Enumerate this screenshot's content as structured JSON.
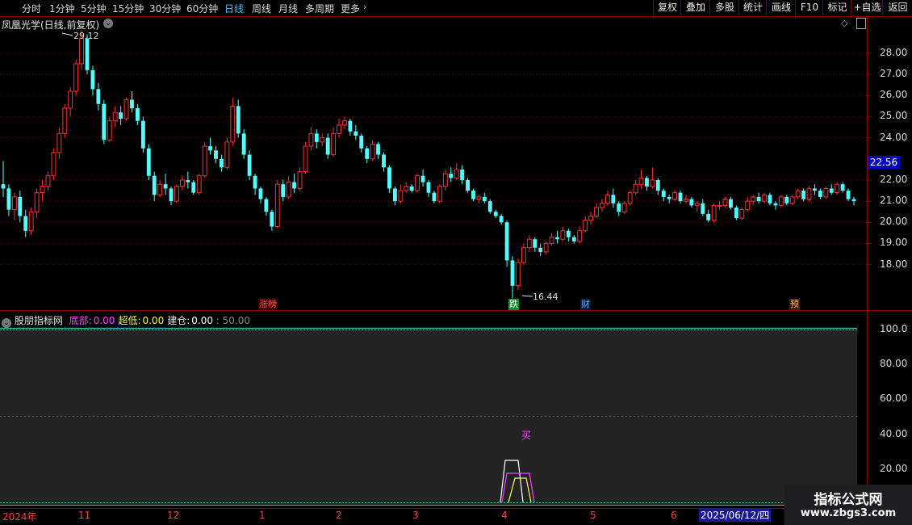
{
  "toolbar": {
    "timeframes": [
      "分时",
      "1分钟",
      "5分钟",
      "15分钟",
      "30分钟",
      "60分钟",
      "日线",
      "周线",
      "月线",
      "多周期",
      "更多"
    ],
    "active_timeframe": "日线",
    "right_buttons": [
      "复权",
      "叠加",
      "多股",
      "统计",
      "画线",
      "F10",
      "标记",
      "+自选",
      "返回"
    ]
  },
  "chart": {
    "title": "凤凰光学(日线,前复权)",
    "high_label": "29.12",
    "low_label": "16.44",
    "current_price": "22.56",
    "price_axis": [
      "28.00",
      "27.00",
      "26.00",
      "25.00",
      "24.00",
      "22.00",
      "21.00",
      "20.00",
      "19.00",
      "18.00"
    ],
    "event_tags": [
      {
        "text": "涨榜",
        "color": "#ff5050",
        "bg": "#3a0000"
      },
      {
        "text": "跌",
        "color": "#ffffff",
        "bg": "#138a2c"
      },
      {
        "text": "财",
        "color": "#60a8ff",
        "bg": "#0c1a38"
      },
      {
        "text": "预",
        "color": "#ffb070",
        "bg": "#3a1a00"
      }
    ]
  },
  "indicator": {
    "name": "股朋指标网",
    "fields": [
      {
        "label": "底部:",
        "value": "0.00",
        "color": "#ff40ff"
      },
      {
        "label": "超低:",
        "value": "0.00",
        "color": "#ffff40"
      },
      {
        "label": "建仓:",
        "value": "0.00",
        "color": "#ffffff"
      }
    ],
    "extra": ": 50.00",
    "axis": [
      "100.0",
      "80.00",
      "60.00",
      "40.00",
      "20.00"
    ],
    "signal_text": "买"
  },
  "dates": [
    "2024年",
    "11",
    "12",
    "1",
    "2",
    "3",
    "4",
    "5",
    "6"
  ],
  "cursor_date": "2025/06/12/四",
  "watermark": {
    "title": "指标公式网",
    "url": "www.zbgs3.com"
  },
  "colors": {
    "up": "#ff3030",
    "down": "#54ffff",
    "grid": "#7a0000",
    "active": "#3fc3ff"
  },
  "chart_data": {
    "type": "candlestick",
    "ylim": [
      16,
      29.6
    ],
    "candles": [
      [
        21.8,
        22.9,
        21.2,
        21.6
      ],
      [
        21.6,
        21.8,
        20.3,
        20.6
      ],
      [
        20.6,
        21.4,
        20.1,
        21.2
      ],
      [
        21.2,
        21.5,
        20.0,
        20.3
      ],
      [
        20.3,
        20.6,
        19.3,
        19.6
      ],
      [
        19.6,
        20.7,
        19.4,
        20.5
      ],
      [
        20.5,
        21.6,
        20.2,
        21.4
      ],
      [
        21.4,
        22.0,
        21.0,
        21.7
      ],
      [
        21.7,
        22.4,
        21.5,
        22.2
      ],
      [
        22.2,
        23.5,
        22.0,
        23.3
      ],
      [
        23.3,
        24.5,
        23.0,
        24.2
      ],
      [
        24.2,
        25.6,
        24.0,
        25.4
      ],
      [
        25.4,
        26.4,
        25.0,
        26.2
      ],
      [
        26.2,
        27.7,
        26.0,
        27.5
      ],
      [
        27.5,
        29.1,
        27.2,
        28.7
      ],
      [
        28.7,
        28.9,
        27.0,
        27.2
      ],
      [
        27.2,
        27.4,
        26.0,
        26.3
      ],
      [
        26.3,
        26.6,
        25.3,
        25.6
      ],
      [
        25.6,
        25.8,
        23.7,
        23.9
      ],
      [
        23.9,
        25.0,
        23.8,
        24.8
      ],
      [
        24.8,
        25.5,
        24.5,
        25.2
      ],
      [
        25.2,
        25.5,
        24.6,
        24.9
      ],
      [
        24.9,
        25.9,
        24.8,
        25.8
      ],
      [
        25.8,
        26.2,
        25.2,
        25.4
      ],
      [
        25.4,
        25.6,
        24.6,
        24.8
      ],
      [
        24.8,
        25.0,
        23.3,
        23.5
      ],
      [
        23.5,
        23.7,
        22.0,
        22.2
      ],
      [
        22.2,
        22.4,
        21.0,
        21.3
      ],
      [
        21.3,
        22.0,
        21.2,
        21.8
      ],
      [
        21.8,
        22.3,
        21.3,
        21.6
      ],
      [
        21.6,
        21.7,
        20.8,
        21.0
      ],
      [
        21.0,
        21.8,
        20.9,
        21.7
      ],
      [
        21.7,
        22.2,
        21.5,
        22.0
      ],
      [
        22.0,
        22.4,
        21.6,
        21.9
      ],
      [
        21.9,
        22.0,
        21.3,
        21.4
      ],
      [
        21.4,
        22.3,
        21.3,
        22.2
      ],
      [
        22.2,
        23.8,
        22.1,
        23.6
      ],
      [
        23.6,
        24.0,
        23.2,
        23.4
      ],
      [
        23.4,
        23.6,
        22.8,
        23.0
      ],
      [
        23.0,
        23.2,
        22.4,
        22.6
      ],
      [
        22.6,
        24.0,
        22.5,
        23.8
      ],
      [
        23.8,
        25.9,
        23.6,
        25.5
      ],
      [
        25.5,
        25.8,
        24.0,
        24.2
      ],
      [
        24.2,
        24.4,
        23.0,
        23.2
      ],
      [
        23.2,
        23.4,
        22.0,
        22.2
      ],
      [
        22.2,
        22.3,
        21.3,
        21.6
      ],
      [
        21.6,
        21.7,
        20.9,
        21.1
      ],
      [
        21.1,
        21.2,
        20.3,
        20.5
      ],
      [
        20.5,
        20.6,
        19.6,
        19.8
      ],
      [
        19.8,
        22.0,
        19.7,
        21.8
      ],
      [
        21.8,
        22.0,
        21.0,
        21.2
      ],
      [
        21.2,
        22.2,
        21.1,
        21.9
      ],
      [
        21.9,
        22.3,
        21.4,
        21.6
      ],
      [
        21.6,
        22.6,
        21.5,
        22.4
      ],
      [
        22.4,
        23.8,
        22.3,
        23.6
      ],
      [
        23.6,
        24.5,
        23.4,
        24.2
      ],
      [
        24.2,
        24.4,
        23.5,
        23.8
      ],
      [
        23.8,
        24.2,
        23.6,
        24.0
      ],
      [
        24.0,
        24.2,
        23.0,
        23.2
      ],
      [
        23.2,
        24.5,
        23.1,
        24.2
      ],
      [
        24.2,
        24.9,
        24.0,
        24.6
      ],
      [
        24.6,
        25.0,
        24.4,
        24.8
      ],
      [
        24.8,
        24.9,
        24.1,
        24.3
      ],
      [
        24.3,
        24.6,
        23.9,
        24.1
      ],
      [
        24.1,
        24.2,
        23.3,
        23.5
      ],
      [
        23.5,
        23.6,
        22.8,
        23.0
      ],
      [
        23.0,
        23.9,
        22.9,
        23.7
      ],
      [
        23.7,
        23.8,
        23.0,
        23.2
      ],
      [
        23.2,
        23.3,
        22.4,
        22.6
      ],
      [
        22.6,
        22.7,
        21.4,
        21.6
      ],
      [
        21.6,
        21.7,
        20.8,
        21.0
      ],
      [
        21.0,
        21.8,
        20.9,
        21.5
      ],
      [
        21.5,
        21.9,
        21.4,
        21.7
      ],
      [
        21.7,
        21.8,
        21.4,
        21.5
      ],
      [
        21.5,
        22.3,
        21.4,
        22.2
      ],
      [
        22.2,
        22.5,
        21.7,
        21.9
      ],
      [
        21.9,
        22.0,
        21.2,
        21.4
      ],
      [
        21.4,
        21.5,
        20.9,
        21.0
      ],
      [
        21.0,
        21.8,
        20.9,
        21.7
      ],
      [
        21.7,
        22.5,
        21.5,
        22.3
      ],
      [
        22.3,
        22.6,
        21.9,
        22.1
      ],
      [
        22.1,
        22.8,
        22.0,
        22.5
      ],
      [
        22.5,
        22.7,
        21.8,
        22.0
      ],
      [
        22.0,
        22.1,
        21.4,
        21.5
      ],
      [
        21.5,
        21.6,
        21.0,
        21.1
      ],
      [
        21.1,
        21.3,
        20.9,
        21.2
      ],
      [
        21.2,
        21.4,
        20.9,
        21.0
      ],
      [
        21.0,
        21.1,
        20.4,
        20.5
      ],
      [
        20.5,
        20.6,
        20.2,
        20.3
      ],
      [
        20.3,
        20.4,
        19.9,
        20.0
      ],
      [
        20.0,
        20.1,
        17.9,
        18.2
      ],
      [
        18.2,
        18.4,
        16.4,
        17.0
      ],
      [
        17.0,
        18.3,
        16.8,
        18.1
      ],
      [
        18.1,
        19.0,
        18.0,
        18.8
      ],
      [
        18.8,
        19.4,
        18.6,
        19.2
      ],
      [
        19.2,
        19.3,
        18.6,
        18.8
      ],
      [
        18.8,
        19.0,
        18.4,
        18.6
      ],
      [
        18.6,
        19.1,
        18.5,
        19.0
      ],
      [
        19.0,
        19.5,
        18.9,
        19.3
      ],
      [
        19.3,
        19.6,
        19.0,
        19.2
      ],
      [
        19.2,
        19.8,
        19.1,
        19.6
      ],
      [
        19.6,
        19.7,
        19.1,
        19.3
      ],
      [
        19.3,
        19.4,
        19.0,
        19.1
      ],
      [
        19.1,
        19.8,
        19.0,
        19.6
      ],
      [
        19.6,
        20.3,
        19.5,
        20.1
      ],
      [
        20.1,
        20.5,
        19.9,
        20.3
      ],
      [
        20.3,
        20.9,
        20.2,
        20.7
      ],
      [
        20.7,
        21.1,
        20.5,
        20.9
      ],
      [
        20.9,
        21.5,
        20.8,
        21.3
      ],
      [
        21.3,
        21.6,
        20.7,
        20.9
      ],
      [
        20.9,
        21.0,
        20.3,
        20.5
      ],
      [
        20.5,
        21.0,
        20.4,
        20.9
      ],
      [
        20.9,
        21.5,
        20.8,
        21.4
      ],
      [
        21.4,
        22.0,
        21.3,
        21.8
      ],
      [
        21.8,
        22.5,
        21.6,
        22.1
      ],
      [
        22.1,
        22.2,
        21.5,
        21.7
      ],
      [
        21.7,
        22.6,
        21.6,
        22.0
      ],
      [
        22.0,
        22.1,
        21.3,
        21.5
      ],
      [
        21.5,
        21.6,
        21.0,
        21.2
      ],
      [
        21.2,
        21.3,
        20.9,
        21.1
      ],
      [
        21.1,
        21.5,
        21.0,
        21.4
      ],
      [
        21.4,
        21.5,
        20.9,
        21.0
      ],
      [
        21.0,
        21.3,
        20.9,
        21.1
      ],
      [
        21.1,
        21.2,
        20.7,
        20.8
      ],
      [
        20.8,
        21.0,
        20.5,
        20.9
      ],
      [
        20.9,
        21.1,
        20.3,
        20.4
      ],
      [
        20.4,
        20.6,
        20.0,
        20.1
      ],
      [
        20.1,
        20.9,
        20.0,
        20.8
      ],
      [
        20.8,
        21.0,
        20.6,
        20.8
      ],
      [
        20.8,
        21.2,
        20.7,
        21.1
      ],
      [
        21.1,
        21.2,
        20.6,
        20.7
      ],
      [
        20.7,
        20.8,
        20.1,
        20.2
      ],
      [
        20.2,
        20.7,
        20.1,
        20.6
      ],
      [
        20.6,
        21.2,
        20.5,
        21.0
      ],
      [
        21.0,
        21.3,
        20.8,
        21.2
      ],
      [
        21.2,
        21.4,
        20.9,
        21.0
      ],
      [
        21.0,
        21.4,
        20.9,
        21.3
      ],
      [
        21.3,
        21.4,
        20.8,
        20.9
      ],
      [
        20.9,
        21.0,
        20.6,
        20.8
      ],
      [
        20.8,
        21.3,
        20.7,
        21.2
      ],
      [
        21.2,
        21.3,
        20.8,
        20.9
      ],
      [
        20.9,
        21.3,
        20.8,
        21.2
      ],
      [
        21.2,
        21.6,
        21.1,
        21.5
      ],
      [
        21.5,
        21.6,
        21.0,
        21.1
      ],
      [
        21.1,
        21.7,
        21.0,
        21.6
      ],
      [
        21.6,
        21.8,
        21.3,
        21.5
      ],
      [
        21.5,
        21.6,
        21.1,
        21.2
      ],
      [
        21.2,
        21.7,
        21.1,
        21.6
      ],
      [
        21.6,
        21.8,
        21.3,
        21.4
      ],
      [
        21.4,
        21.9,
        21.3,
        21.8
      ],
      [
        21.8,
        21.9,
        21.4,
        21.5
      ],
      [
        21.5,
        21.6,
        21.0,
        21.1
      ],
      [
        21.1,
        21.2,
        20.8,
        21.0
      ]
    ]
  }
}
